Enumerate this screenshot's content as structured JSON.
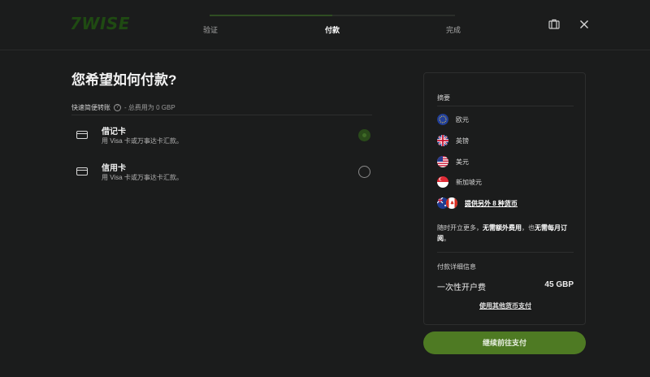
{
  "header": {
    "logo": "7WISE",
    "steps": [
      {
        "label": "验证",
        "active": false
      },
      {
        "label": "付款",
        "active": true
      },
      {
        "label": "完成",
        "active": false
      }
    ],
    "progress": 0.5,
    "icons": [
      "briefcase-icon",
      "close-icon"
    ]
  },
  "main": {
    "title": "您希望如何付款?",
    "quick": {
      "label": "快速简便转账",
      "fee": "- 总费用为 0 GBP"
    },
    "options": [
      {
        "title": "借记卡",
        "desc": "用 Visa 卡或万事达卡汇款。",
        "selected": true
      },
      {
        "title": "信用卡",
        "desc": "用 Visa 卡或万事达卡汇款。",
        "selected": false
      }
    ]
  },
  "summary": {
    "title": "摘要",
    "currencies": [
      {
        "flag": "eu-flag-icon",
        "label": "欧元"
      },
      {
        "flag": "uk-flag-icon",
        "label": "英镑"
      },
      {
        "flag": "us-flag-icon",
        "label": "美元"
      },
      {
        "flag": "sg-flag-icon",
        "label": "新加坡元"
      }
    ],
    "more_link": "提供另外 8 种货币",
    "note_prefix": "随时开立更多，",
    "note_bold1": "无需额外费用",
    "note_mid": "，也",
    "note_bold2": "无需每月订阅",
    "note_suffix": "。",
    "details_title": "付款详细信息",
    "fee_label": "一次性开户费",
    "fee_value": "45 GBP",
    "pay_other": "使用其他货币支付"
  },
  "cta": {
    "label": "继续前往支付",
    "color": "#4e7a23"
  },
  "colors": {
    "accent": "#4e7a23",
    "background": "#1b1c1c"
  }
}
